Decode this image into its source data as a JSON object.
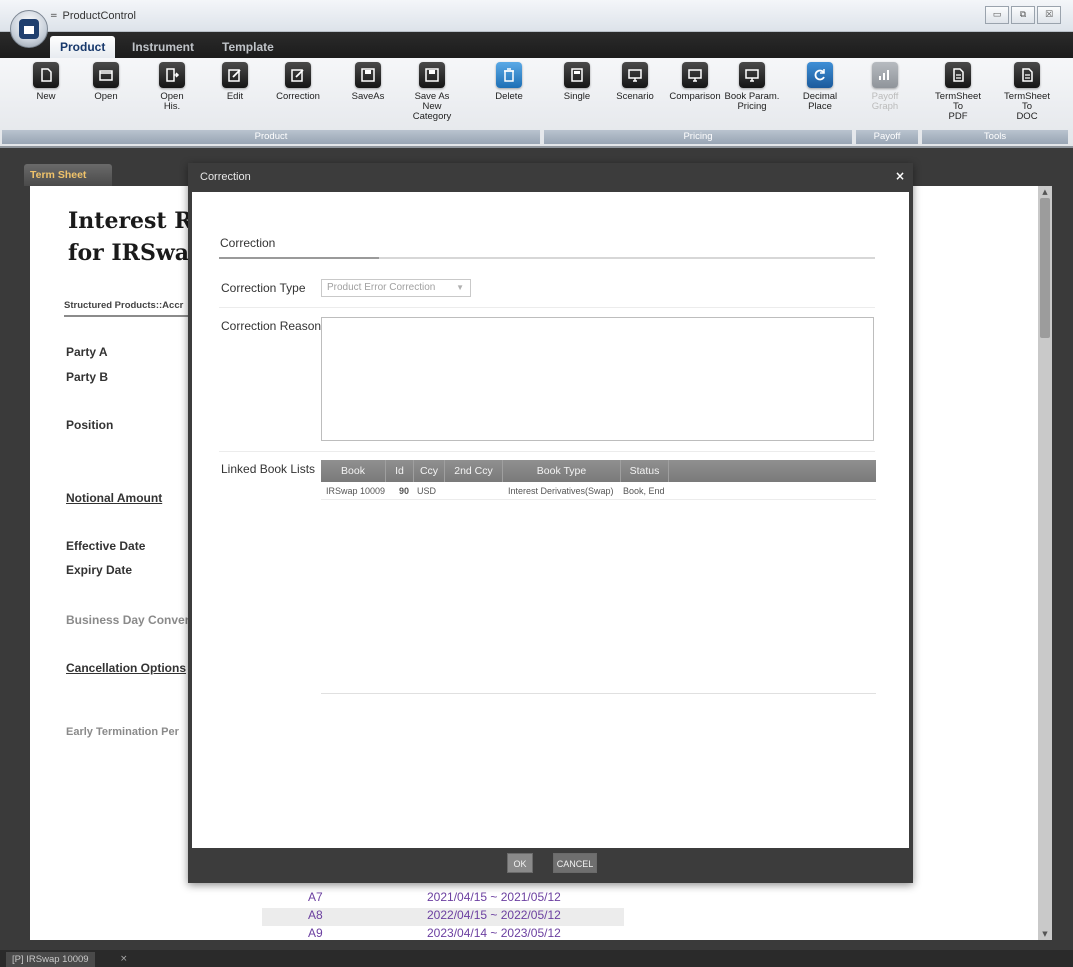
{
  "window": {
    "title": "ProductControl",
    "qa_menu": "=",
    "controls": {
      "minimize": "▭",
      "restore": "⧉",
      "close": "☒"
    }
  },
  "ribbon_tabs": [
    "Product",
    "Instrument",
    "Template"
  ],
  "ribbon": {
    "buttons": {
      "new": "New",
      "open": "Open",
      "open_his": "Open\nHis.",
      "edit": "Edit",
      "correction": "Correction",
      "saveas": "SaveAs",
      "save_as_new_category": "Save As\nNew Category",
      "delete": "Delete",
      "single": "Single",
      "scenario": "Scenario",
      "comparison": "Comparison",
      "book_param_pricing": "Book Param.\nPricing",
      "decimal_place": "Decimal\nPlace",
      "payoff_graph": "Payoff\nGraph",
      "termsheet_pdf": "TermSheet To\nPDF",
      "termsheet_doc": "TermSheet To\nDOC"
    },
    "groups": {
      "product": "Product",
      "pricing": "Pricing",
      "payoff": "Payoff",
      "tools": "Tools"
    }
  },
  "document": {
    "tab": "Term Sheet",
    "title_line1": "Interest Ra",
    "title_line2": "for IRSwa",
    "breadcrumb": "Structured Products::Accr",
    "fields": {
      "party_a": "Party A",
      "party_b": "Party B",
      "position": "Position",
      "notional_amount": "Notional Amount",
      "effective_date": "Effective Date",
      "expiry_date": "Expiry Date",
      "business_day": "Business Day Convent",
      "cancellation_options": "Cancellation Options",
      "early_termination": "Early Termination Per"
    },
    "schedule": [
      {
        "label": "A7",
        "period": "2021/04/15 ~ 2021/05/12"
      },
      {
        "label": "A8",
        "period": "2022/04/15 ~ 2022/05/12"
      },
      {
        "label": "A9",
        "period": "2023/04/14 ~ 2023/05/12"
      }
    ]
  },
  "statusbar": {
    "tab": "[P] IRSwap 10009",
    "close": "×"
  },
  "modal": {
    "title": "Correction",
    "close": "×",
    "section": "Correction",
    "correction_type_label": "Correction Type",
    "correction_type_value": "Product Error Correction",
    "correction_reason_label": "Correction Reason",
    "correction_reason_value": "",
    "linked_books_label": "Linked Book Lists",
    "grid": {
      "columns": [
        "Book",
        "Id",
        "Ccy",
        "2nd Ccy",
        "Book Type",
        "Status"
      ],
      "rows": [
        {
          "book": "IRSwap 10009",
          "id": "90",
          "ccy": "USD",
          "ccy2": "",
          "book_type": "Interest Derivatives(Swap)",
          "status": "Book, End"
        }
      ]
    },
    "ok_label": "OK",
    "cancel_label": "CANCEL"
  }
}
